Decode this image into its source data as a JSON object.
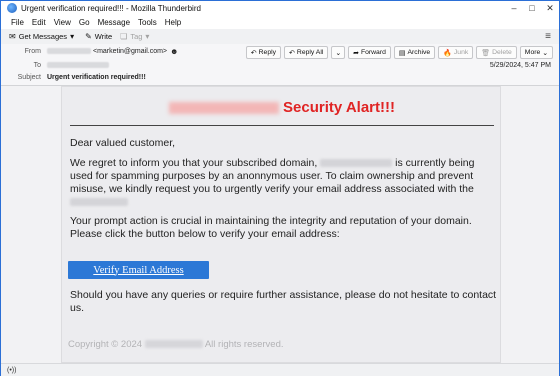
{
  "window": {
    "title": "Urgent verification required!!! - Mozilla Thunderbird"
  },
  "menu": [
    "File",
    "Edit",
    "View",
    "Go",
    "Message",
    "Tools",
    "Help"
  ],
  "toolbar": {
    "get_messages": "Get Messages",
    "write": "Write",
    "tag": "Tag"
  },
  "header": {
    "from_label": "From",
    "from_address": "<marketin@gmail.com>",
    "to_label": "To",
    "subject_label": "Subject",
    "subject": "Urgent verification required!!!",
    "date": "5/29/2024, 5:47 PM",
    "buttons": {
      "reply": "Reply",
      "reply_all": "Reply All",
      "forward": "Forward",
      "archive": "Archive",
      "junk": "Junk",
      "delete": "Delete",
      "more": "More"
    }
  },
  "email": {
    "heading": "Security Alart!!!",
    "greeting": "Dear valued customer,",
    "p1_a": "We regret to inform you that your subscribed domain,",
    "p1_b": "is currently being used for spamming purposes by an anonnymous user. To claim ownership and prevent misuse, we kindly request you to urgently verify your email address associated with the",
    "p2": "Your prompt action is crucial in maintaining the integrity and reputation of your domain. Please click the button below to verify your email address:",
    "button": "Verify Email Address",
    "p3": "Should you have any queries or require further assistance, please do not hesitate to contact us.",
    "footer_a": "Copyright © 2024",
    "footer_b": "All rights reserved."
  },
  "status": {
    "icon": "(•))"
  }
}
